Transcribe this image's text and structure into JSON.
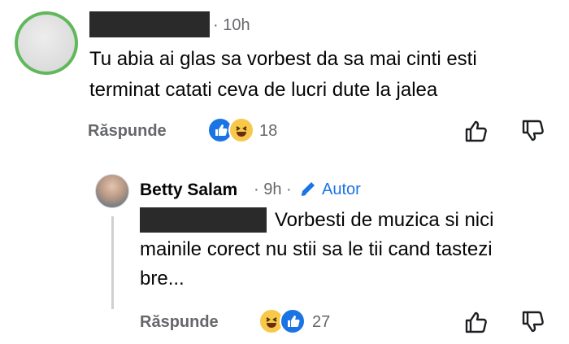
{
  "comment1": {
    "time": "· 10h",
    "text_line1": "Tu abia ai glas sa vorbest da sa mai cinti esti",
    "text_line2": "terminat catati ceva de lucri dute la jalea",
    "reply_label": "Răspunde",
    "reaction_count": "18",
    "reactions": [
      "like",
      "haha"
    ]
  },
  "reply": {
    "name": "Betty Salam",
    "time": "· 9h ·",
    "author_label": "Autor",
    "text_line1": "Vorbesti de muzica si nici",
    "text_line2": "mainile corect nu stii sa le tii cand tastezi",
    "text_line3": "bre...",
    "reply_label": "Răspunde",
    "reaction_count": "27",
    "reactions": [
      "haha",
      "like"
    ]
  },
  "colors": {
    "link_blue": "#1b74e4",
    "meta_gray": "#65676b",
    "avatar_ring_green": "#5fb85a"
  },
  "icons": [
    "like-outline-icon",
    "dislike-outline-icon",
    "pencil-icon",
    "like-reaction-icon",
    "haha-reaction-icon"
  ]
}
